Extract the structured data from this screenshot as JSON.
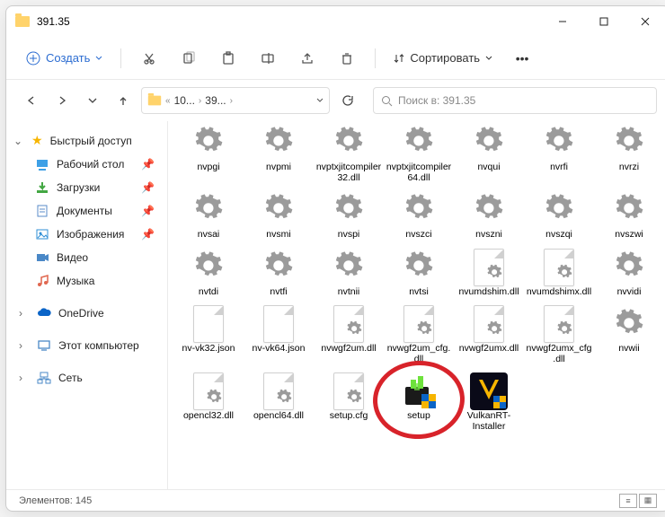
{
  "window": {
    "title": "391.35"
  },
  "toolbar": {
    "create_label": "Создать",
    "sort_label": "Сортировать"
  },
  "breadcrumbs": {
    "segments": [
      "10...",
      "39...",
      ""
    ]
  },
  "search": {
    "placeholder": "Поиск в: 391.35"
  },
  "sidebar": {
    "quick_access": "Быстрый доступ",
    "items": [
      {
        "label": "Рабочий стол",
        "icon": "desktop",
        "pinned": true
      },
      {
        "label": "Загрузки",
        "icon": "downloads",
        "pinned": true
      },
      {
        "label": "Документы",
        "icon": "documents",
        "pinned": true
      },
      {
        "label": "Изображения",
        "icon": "pictures",
        "pinned": true
      },
      {
        "label": "Видео",
        "icon": "video",
        "pinned": false
      },
      {
        "label": "Музыка",
        "icon": "music",
        "pinned": false
      }
    ],
    "onedrive": "OneDrive",
    "this_pc": "Этот компьютер",
    "network": "Сеть"
  },
  "files": [
    {
      "name": "nvpgi",
      "kind": "gear"
    },
    {
      "name": "nvpmi",
      "kind": "gear"
    },
    {
      "name": "nvptxjitcompiler32.dll",
      "kind": "gear"
    },
    {
      "name": "nvptxjitcompiler64.dll",
      "kind": "gear"
    },
    {
      "name": "nvqui",
      "kind": "gear"
    },
    {
      "name": "nvrfi",
      "kind": "gear"
    },
    {
      "name": "nvrzi",
      "kind": "gear"
    },
    {
      "name": "nvsai",
      "kind": "gear"
    },
    {
      "name": "nvsmi",
      "kind": "gear"
    },
    {
      "name": "nvspi",
      "kind": "gear"
    },
    {
      "name": "nvszci",
      "kind": "gear"
    },
    {
      "name": "nvszni",
      "kind": "gear"
    },
    {
      "name": "nvszqi",
      "kind": "gear"
    },
    {
      "name": "nvszwi",
      "kind": "gear"
    },
    {
      "name": "nvtdi",
      "kind": "gear"
    },
    {
      "name": "nvtfi",
      "kind": "gear"
    },
    {
      "name": "nvtnii",
      "kind": "gear"
    },
    {
      "name": "nvtsi",
      "kind": "gear"
    },
    {
      "name": "nvumdshim.dll",
      "kind": "dll"
    },
    {
      "name": "nvumdshimx.dll",
      "kind": "dll"
    },
    {
      "name": "nvvidi",
      "kind": "gear"
    },
    {
      "name": "nv-vk32.json",
      "kind": "plain"
    },
    {
      "name": "nv-vk64.json",
      "kind": "plain"
    },
    {
      "name": "nvwgf2um.dll",
      "kind": "dll"
    },
    {
      "name": "nvwgf2um_cfg.dll",
      "kind": "dll"
    },
    {
      "name": "nvwgf2umx.dll",
      "kind": "dll"
    },
    {
      "name": "nvwgf2umx_cfg.dll",
      "kind": "dll"
    },
    {
      "name": "nvwii",
      "kind": "gear"
    },
    {
      "name": "opencl32.dll",
      "kind": "dll"
    },
    {
      "name": "opencl64.dll",
      "kind": "dll"
    },
    {
      "name": "setup.cfg",
      "kind": "dll"
    },
    {
      "name": "setup",
      "kind": "exe"
    },
    {
      "name": "VulkanRT-Installer",
      "kind": "vulkan"
    }
  ],
  "status": {
    "count_label": "Элементов:",
    "count": "145"
  },
  "highlight": {
    "file_index": 31
  }
}
